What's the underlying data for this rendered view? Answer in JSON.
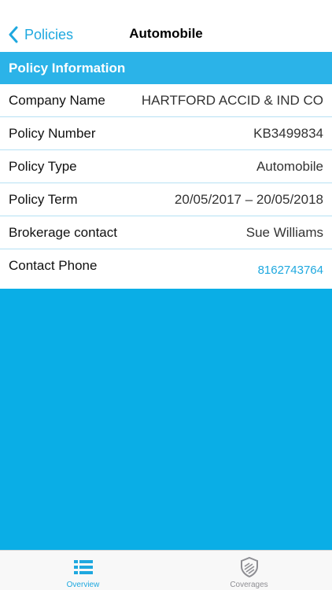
{
  "nav": {
    "back_label": "Policies",
    "title": "Automobile"
  },
  "section": {
    "title": "Policy Information"
  },
  "rows": [
    {
      "label": "Company Name",
      "value": "HARTFORD ACCID & IND CO"
    },
    {
      "label": "Policy Number",
      "value": "KB3499834"
    },
    {
      "label": "Policy Type",
      "value": "Automobile"
    },
    {
      "label": "Policy Term",
      "value": "20/05/2017 – 20/05/2018"
    },
    {
      "label": "Brokerage contact",
      "value": "Sue Williams"
    },
    {
      "label": "Contact Phone",
      "value": "8162743764"
    }
  ],
  "tabs": [
    {
      "label": "Overview",
      "icon": "list-icon",
      "active": true
    },
    {
      "label": "Coverages",
      "icon": "shield-icon",
      "active": false
    }
  ],
  "colors": {
    "accent": "#1EA8DF",
    "header": "#2BB3E8",
    "background": "#0AAEE6"
  }
}
